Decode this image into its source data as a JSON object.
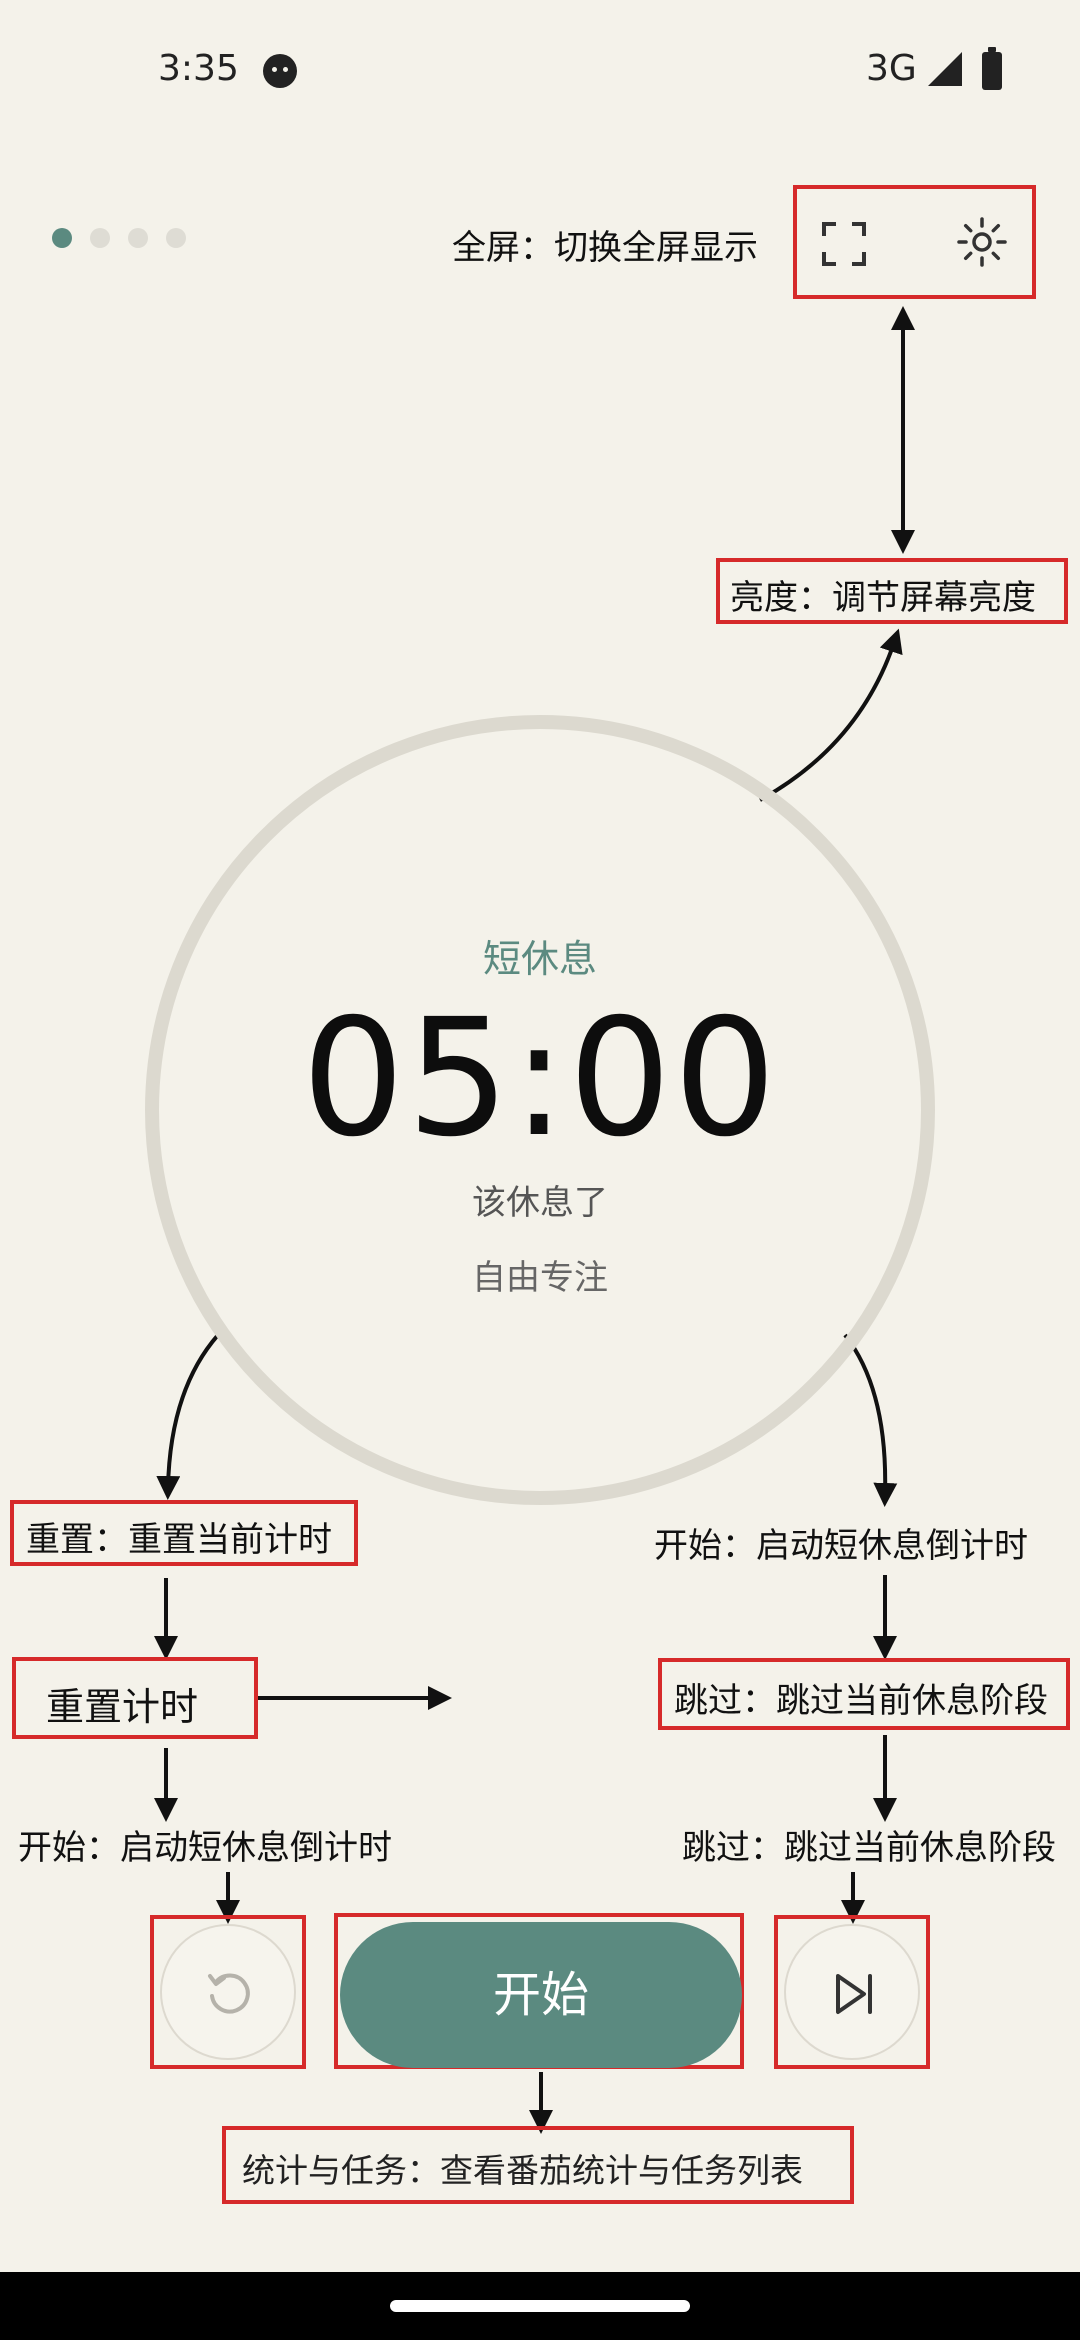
{
  "status_bar": {
    "time": "3:35",
    "network": "3G"
  },
  "pager": {
    "count": 4,
    "active_index": 0
  },
  "timer": {
    "phase": "短休息",
    "time": "05:00",
    "message": "该休息了",
    "mode": "自由专注"
  },
  "buttons": {
    "start_label": "开始"
  },
  "annotations": {
    "fullscreen": "全屏：切换全屏显示",
    "brightness": "亮度：调节屏幕亮度",
    "reset": "重置：重置当前计时",
    "reset_timer": "重置计时",
    "start_left": "开始：启动短休息倒计时",
    "start_right": "开始：启动短休息倒计时",
    "skip_box": "跳过：跳过当前休息阶段",
    "skip_text": "跳过：跳过当前休息阶段",
    "stats": "统计与任务：查看番茄统计与任务列表"
  },
  "colors": {
    "accent": "#5b8a80",
    "background": "#f4f2ea",
    "annotation_border": "#d62a2a"
  }
}
